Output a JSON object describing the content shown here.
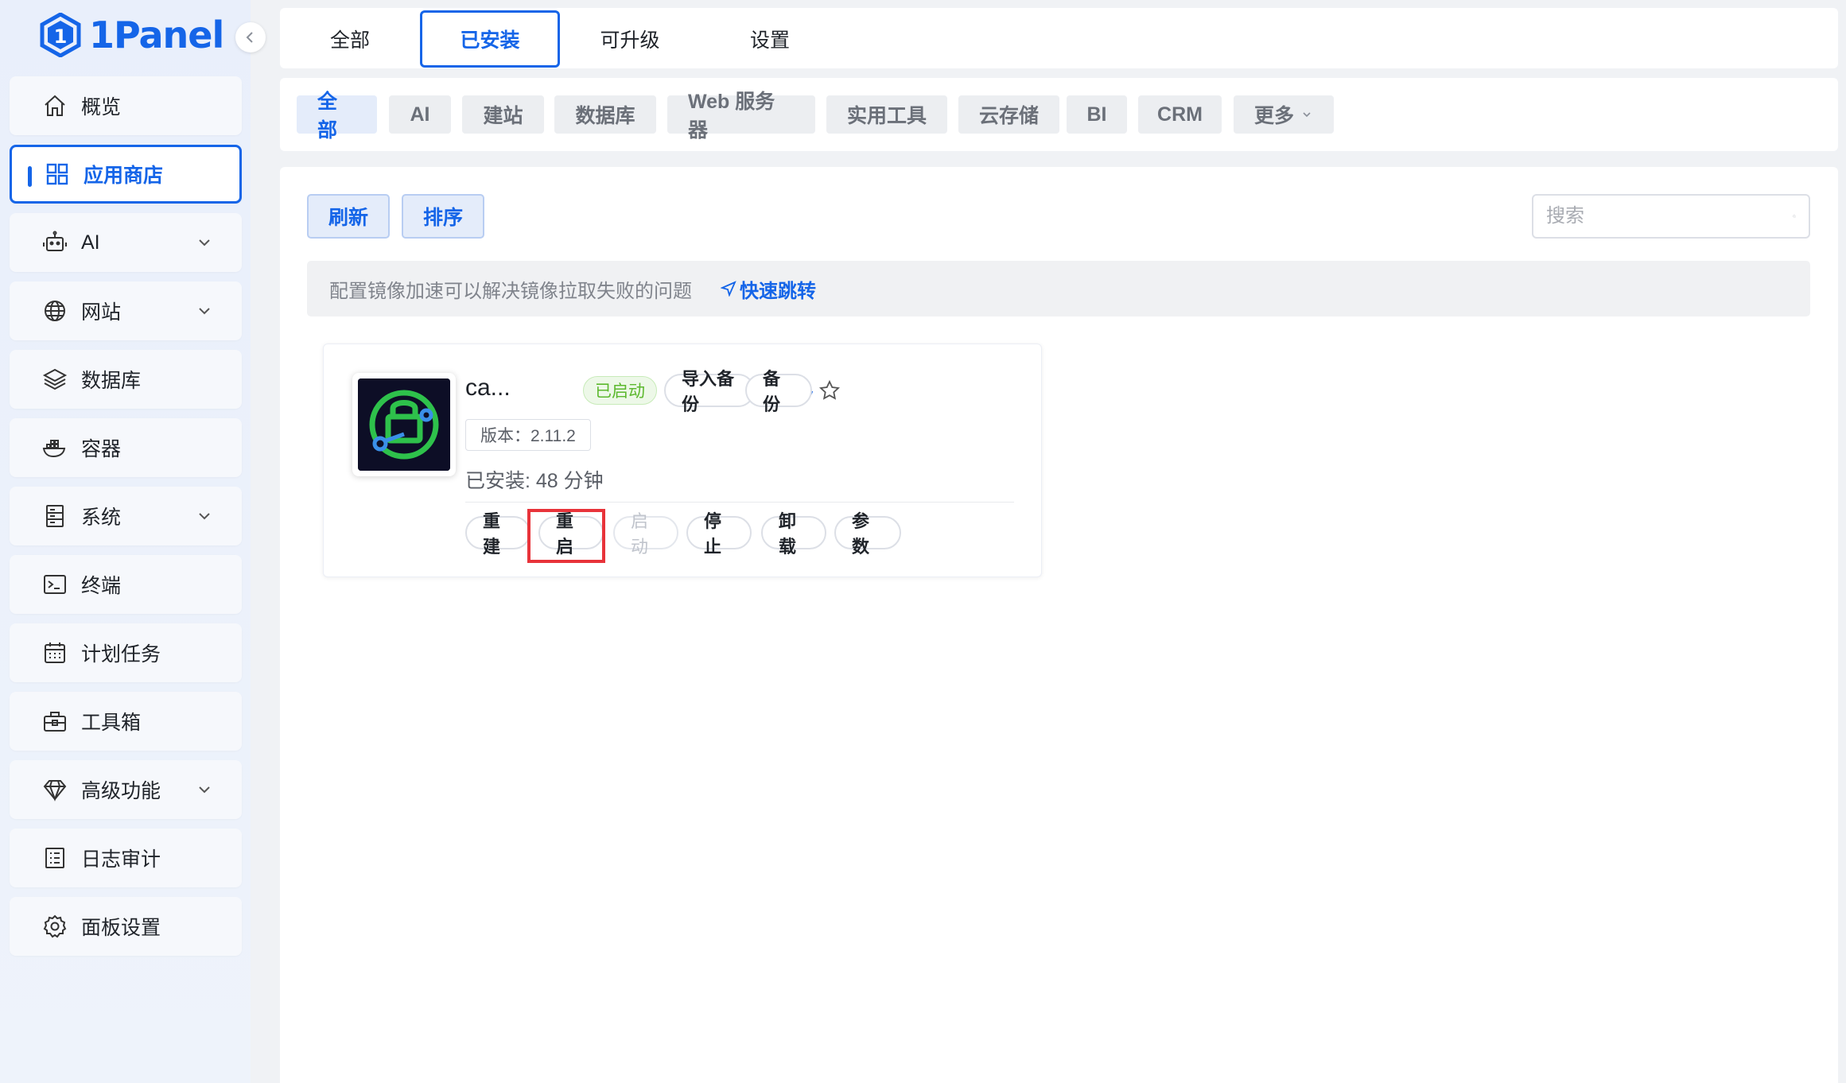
{
  "brand": {
    "name": "1Panel"
  },
  "sidebar": {
    "items": [
      {
        "label": "概览",
        "icon": "home-icon",
        "active": false,
        "expandable": false
      },
      {
        "label": "应用商店",
        "icon": "apps-grid-icon",
        "active": true,
        "expandable": false
      },
      {
        "label": "AI",
        "icon": "robot-icon",
        "active": false,
        "expandable": true
      },
      {
        "label": "网站",
        "icon": "globe-icon",
        "active": false,
        "expandable": true
      },
      {
        "label": "数据库",
        "icon": "layers-icon",
        "active": false,
        "expandable": false
      },
      {
        "label": "容器",
        "icon": "docker-icon",
        "active": false,
        "expandable": false
      },
      {
        "label": "系统",
        "icon": "server-icon",
        "active": false,
        "expandable": true
      },
      {
        "label": "终端",
        "icon": "terminal-icon",
        "active": false,
        "expandable": false
      },
      {
        "label": "计划任务",
        "icon": "calendar-icon",
        "active": false,
        "expandable": false
      },
      {
        "label": "工具箱",
        "icon": "toolbox-icon",
        "active": false,
        "expandable": false
      },
      {
        "label": "高级功能",
        "icon": "diamond-icon",
        "active": false,
        "expandable": true
      },
      {
        "label": "日志审计",
        "icon": "log-icon",
        "active": false,
        "expandable": false
      },
      {
        "label": "面板设置",
        "icon": "gear-icon",
        "active": false,
        "expandable": false
      }
    ]
  },
  "tabs": [
    {
      "label": "全部",
      "active": false
    },
    {
      "label": "已安装",
      "active": true
    },
    {
      "label": "可升级",
      "active": false
    },
    {
      "label": "设置",
      "active": false
    }
  ],
  "categories": [
    {
      "label": "全部",
      "active": true
    },
    {
      "label": "AI",
      "active": false
    },
    {
      "label": "建站",
      "active": false
    },
    {
      "label": "数据库",
      "active": false
    },
    {
      "label": "Web 服务器",
      "active": false
    },
    {
      "label": "实用工具",
      "active": false
    },
    {
      "label": "云存储",
      "active": false
    },
    {
      "label": "BI",
      "active": false
    },
    {
      "label": "CRM",
      "active": false
    },
    {
      "label": "更多",
      "active": false
    }
  ],
  "toolbar": {
    "refresh_label": "刷新",
    "sort_label": "排序",
    "search_placeholder": "搜索"
  },
  "notice": {
    "text": "配置镜像加速可以解决镜像拉取失败的问题",
    "link_label": "快速跳转"
  },
  "app_card": {
    "name": "ca...",
    "status": "已启动",
    "version": "版本：2.11.2",
    "installed": "已安装:   48 分钟",
    "header_actions": {
      "import_backup": "导入备份",
      "backup": "备份"
    },
    "actions": [
      {
        "label": "重建",
        "disabled": false
      },
      {
        "label": "重启",
        "disabled": false
      },
      {
        "label": "启动",
        "disabled": true
      },
      {
        "label": "停止",
        "disabled": false
      },
      {
        "label": "卸载",
        "disabled": false
      },
      {
        "label": "参数",
        "disabled": false
      }
    ]
  },
  "colors": {
    "primary": "#1565e8",
    "success": "#5cb82e",
    "highlight": "#e8333a",
    "app_icon_green": "#2ec14b"
  }
}
